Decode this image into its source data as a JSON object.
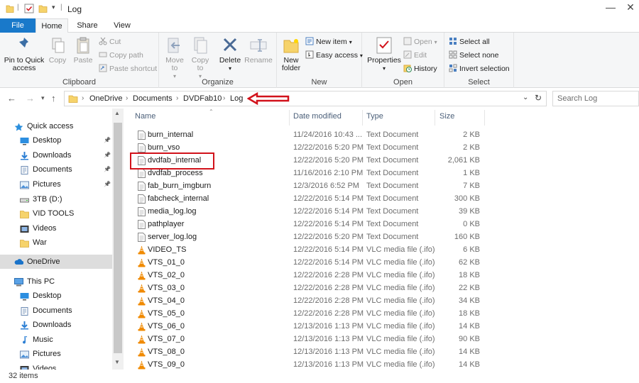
{
  "window": {
    "title": "Log",
    "quick_access_icons": [
      "folder-icon",
      "properties-icon",
      "new-folder-icon",
      "customize-dropdown-icon"
    ],
    "minimize_glyph": "—",
    "close_glyph": "✕"
  },
  "ribbon_tabs": [
    "File",
    "Home",
    "Share",
    "View"
  ],
  "ribbon": {
    "clipboard": {
      "label": "Clipboard",
      "pin": "Pin to Quick access",
      "copy": "Copy",
      "paste": "Paste",
      "cut": "Cut",
      "copy_path": "Copy path",
      "paste_shortcut": "Paste shortcut"
    },
    "organize": {
      "label": "Organize",
      "move_to": "Move to",
      "copy_to": "Copy to",
      "delete": "Delete",
      "rename": "Rename"
    },
    "new": {
      "label": "New",
      "new_folder": "New folder",
      "new_item": "New item",
      "easy_access": "Easy access"
    },
    "open": {
      "label": "Open",
      "properties": "Properties",
      "open": "Open",
      "edit": "Edit",
      "history": "History"
    },
    "select": {
      "label": "Select",
      "select_all": "Select all",
      "select_none": "Select none",
      "invert": "Invert selection"
    }
  },
  "address": {
    "crumbs": [
      "OneDrive",
      "Documents",
      "DVDFab10",
      "Log"
    ],
    "search_placeholder": "Search Log"
  },
  "nav": [
    {
      "label": "Quick access",
      "icon": "star-icon",
      "pinned": false
    },
    {
      "label": "Desktop",
      "icon": "desktop-icon",
      "pinned": true
    },
    {
      "label": "Downloads",
      "icon": "download-icon",
      "pinned": true
    },
    {
      "label": "Documents",
      "icon": "documents-icon",
      "pinned": true
    },
    {
      "label": "Pictures",
      "icon": "pictures-icon",
      "pinned": true
    },
    {
      "label": "3TB (D:)",
      "icon": "drive-icon",
      "pinned": false
    },
    {
      "label": "VID TOOLS",
      "icon": "folder-icon",
      "pinned": false
    },
    {
      "label": "Videos",
      "icon": "videos-icon",
      "pinned": false
    },
    {
      "label": "War",
      "icon": "folder-icon",
      "pinned": false
    },
    {
      "label": "OneDrive",
      "icon": "cloud-icon",
      "pinned": false
    },
    {
      "label": "This PC",
      "icon": "computer-icon",
      "pinned": false
    },
    {
      "label": "Desktop",
      "icon": "desktop-icon",
      "pinned": false
    },
    {
      "label": "Documents",
      "icon": "documents-icon",
      "pinned": false
    },
    {
      "label": "Downloads",
      "icon": "download-icon",
      "pinned": false
    },
    {
      "label": "Music",
      "icon": "music-icon",
      "pinned": false
    },
    {
      "label": "Pictures",
      "icon": "pictures-icon",
      "pinned": false
    },
    {
      "label": "Videos",
      "icon": "videos-icon",
      "pinned": false
    }
  ],
  "columns": [
    "Name",
    "Date modified",
    "Type",
    "Size"
  ],
  "files": [
    {
      "name": "burn_internal",
      "date": "11/24/2016 10:43 ...",
      "type": "Text Document",
      "size": "2 KB",
      "icon": "text-file-icon"
    },
    {
      "name": "burn_vso",
      "date": "12/22/2016 5:20 PM",
      "type": "Text Document",
      "size": "2 KB",
      "icon": "text-file-icon"
    },
    {
      "name": "dvdfab_internal",
      "date": "12/22/2016 5:20 PM",
      "type": "Text Document",
      "size": "2,061 KB",
      "icon": "text-file-icon"
    },
    {
      "name": "dvdfab_process",
      "date": "11/16/2016 2:10 PM",
      "type": "Text Document",
      "size": "1 KB",
      "icon": "text-file-icon"
    },
    {
      "name": "fab_burn_imgburn",
      "date": "12/3/2016 6:52 PM",
      "type": "Text Document",
      "size": "7 KB",
      "icon": "text-file-icon"
    },
    {
      "name": "fabcheck_internal",
      "date": "12/22/2016 5:14 PM",
      "type": "Text Document",
      "size": "300 KB",
      "icon": "text-file-icon"
    },
    {
      "name": "media_log.log",
      "date": "12/22/2016 5:14 PM",
      "type": "Text Document",
      "size": "39 KB",
      "icon": "text-file-icon"
    },
    {
      "name": "pathplayer",
      "date": "12/22/2016 5:14 PM",
      "type": "Text Document",
      "size": "0 KB",
      "icon": "text-file-icon"
    },
    {
      "name": "server_log.log",
      "date": "12/22/2016 5:20 PM",
      "type": "Text Document",
      "size": "160 KB",
      "icon": "text-file-icon"
    },
    {
      "name": "VIDEO_TS",
      "date": "12/22/2016 5:14 PM",
      "type": "VLC media file (.ifo)",
      "size": "6 KB",
      "icon": "vlc-cone-icon"
    },
    {
      "name": "VTS_01_0",
      "date": "12/22/2016 5:14 PM",
      "type": "VLC media file (.ifo)",
      "size": "62 KB",
      "icon": "vlc-cone-icon"
    },
    {
      "name": "VTS_02_0",
      "date": "12/22/2016 2:28 PM",
      "type": "VLC media file (.ifo)",
      "size": "18 KB",
      "icon": "vlc-cone-icon"
    },
    {
      "name": "VTS_03_0",
      "date": "12/22/2016 2:28 PM",
      "type": "VLC media file (.ifo)",
      "size": "22 KB",
      "icon": "vlc-cone-icon"
    },
    {
      "name": "VTS_04_0",
      "date": "12/22/2016 2:28 PM",
      "type": "VLC media file (.ifo)",
      "size": "34 KB",
      "icon": "vlc-cone-icon"
    },
    {
      "name": "VTS_05_0",
      "date": "12/22/2016 2:28 PM",
      "type": "VLC media file (.ifo)",
      "size": "18 KB",
      "icon": "vlc-cone-icon"
    },
    {
      "name": "VTS_06_0",
      "date": "12/13/2016 1:13 PM",
      "type": "VLC media file (.ifo)",
      "size": "14 KB",
      "icon": "vlc-cone-icon"
    },
    {
      "name": "VTS_07_0",
      "date": "12/13/2016 1:13 PM",
      "type": "VLC media file (.ifo)",
      "size": "90 KB",
      "icon": "vlc-cone-icon"
    },
    {
      "name": "VTS_08_0",
      "date": "12/13/2016 1:13 PM",
      "type": "VLC media file (.ifo)",
      "size": "14 KB",
      "icon": "vlc-cone-icon"
    },
    {
      "name": "VTS_09_0",
      "date": "12/13/2016 1:13 PM",
      "type": "VLC media file (.ifo)",
      "size": "14 KB",
      "icon": "vlc-cone-icon"
    }
  ],
  "status": {
    "item_count": "32 items"
  },
  "colors": {
    "accent": "#1979ca",
    "annotation": "#d2121b",
    "ribbon_bg": "#f5f6f7",
    "selected_nav": "#dddddd"
  }
}
